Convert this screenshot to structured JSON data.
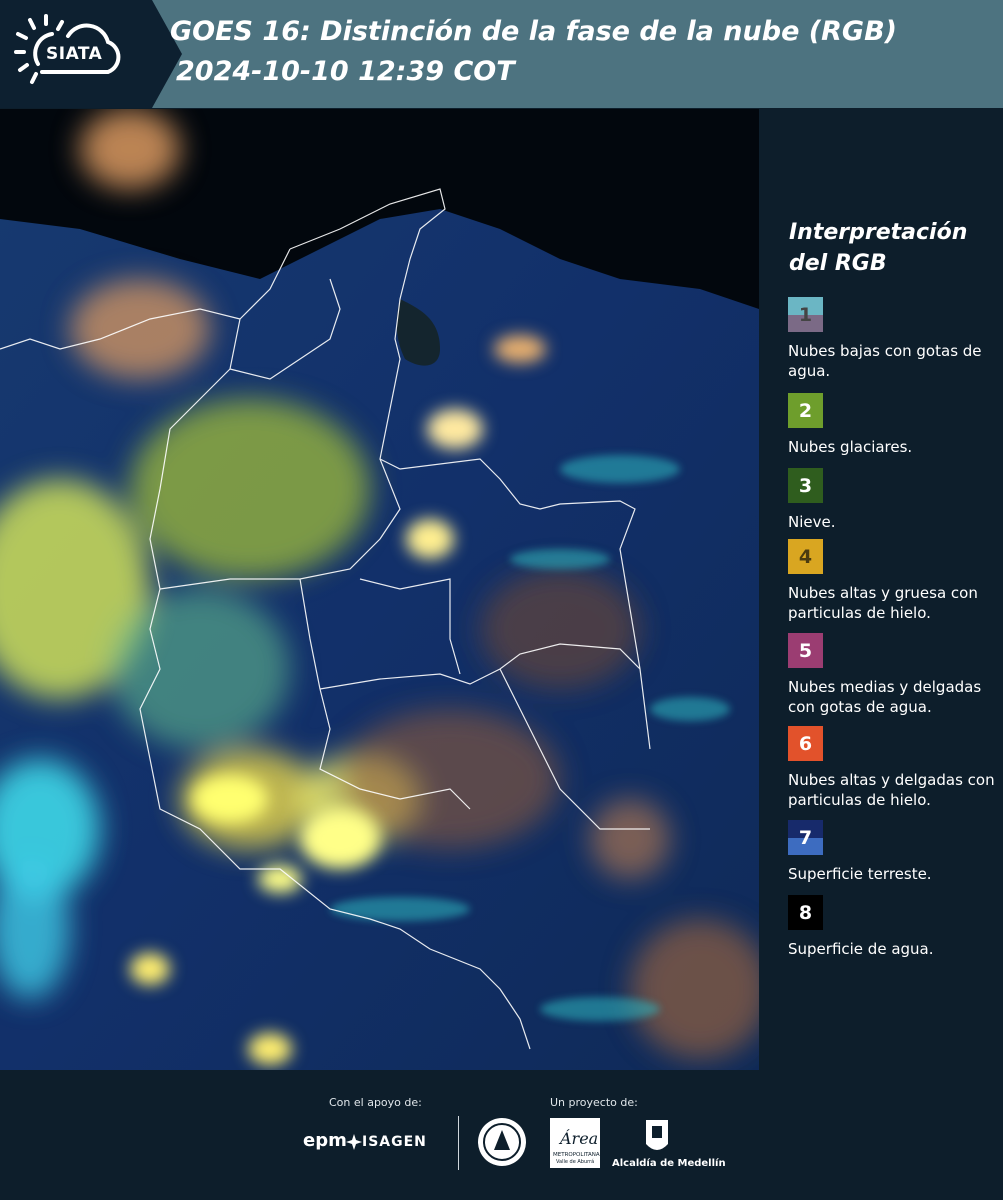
{
  "header": {
    "logo_text": "SIATA",
    "title_line1": "GOES 16: Distinción de la fase de la nube (RGB)",
    "title_line2": "2024-10-10 12:39 COT"
  },
  "legend": {
    "title": "Interpretación del RGB",
    "items": [
      {
        "number": "1",
        "label": "Nubes bajas con gotas de agua.",
        "color_top": "#6bb6c4",
        "color_bottom": "#7b6a86"
      },
      {
        "number": "2",
        "label": "Nubes glaciares.",
        "color_top": "#6e9e2c",
        "color_bottom": "#6e9e2c"
      },
      {
        "number": "3",
        "label": "Nieve.",
        "color_top": "#2f5d1e",
        "color_bottom": "#2f5d1e"
      },
      {
        "number": "4",
        "label": "Nubes altas y gruesa con particulas de hielo.",
        "color_top": "#d9a621",
        "color_bottom": "#d9a621"
      },
      {
        "number": "5",
        "label": "Nubes medias y delgadas con gotas de agua.",
        "color_top": "#9b3d72",
        "color_bottom": "#9b3d72"
      },
      {
        "number": "6",
        "label": "Nubes altas y delgadas con particulas de hielo.",
        "color_top": "#e2522b",
        "color_bottom": "#e2522b"
      },
      {
        "number": "7",
        "label": "Superficie terreste.",
        "color_top": "#172a6b",
        "color_bottom": "#3d6cc0"
      },
      {
        "number": "8",
        "label": "Superficie de agua.",
        "color_top": "#000000",
        "color_bottom": "#000000"
      }
    ]
  },
  "footer": {
    "support_label": "Con el apoyo de:",
    "project_label": "Un proyecto de:",
    "epm": "epm",
    "isagen": "ISAGEN",
    "area_line1": "METROPOLITANA",
    "area_line2": "Valle de Aburrá",
    "area_script": "Área",
    "alcaldia": "Alcaldía de Medellín"
  }
}
